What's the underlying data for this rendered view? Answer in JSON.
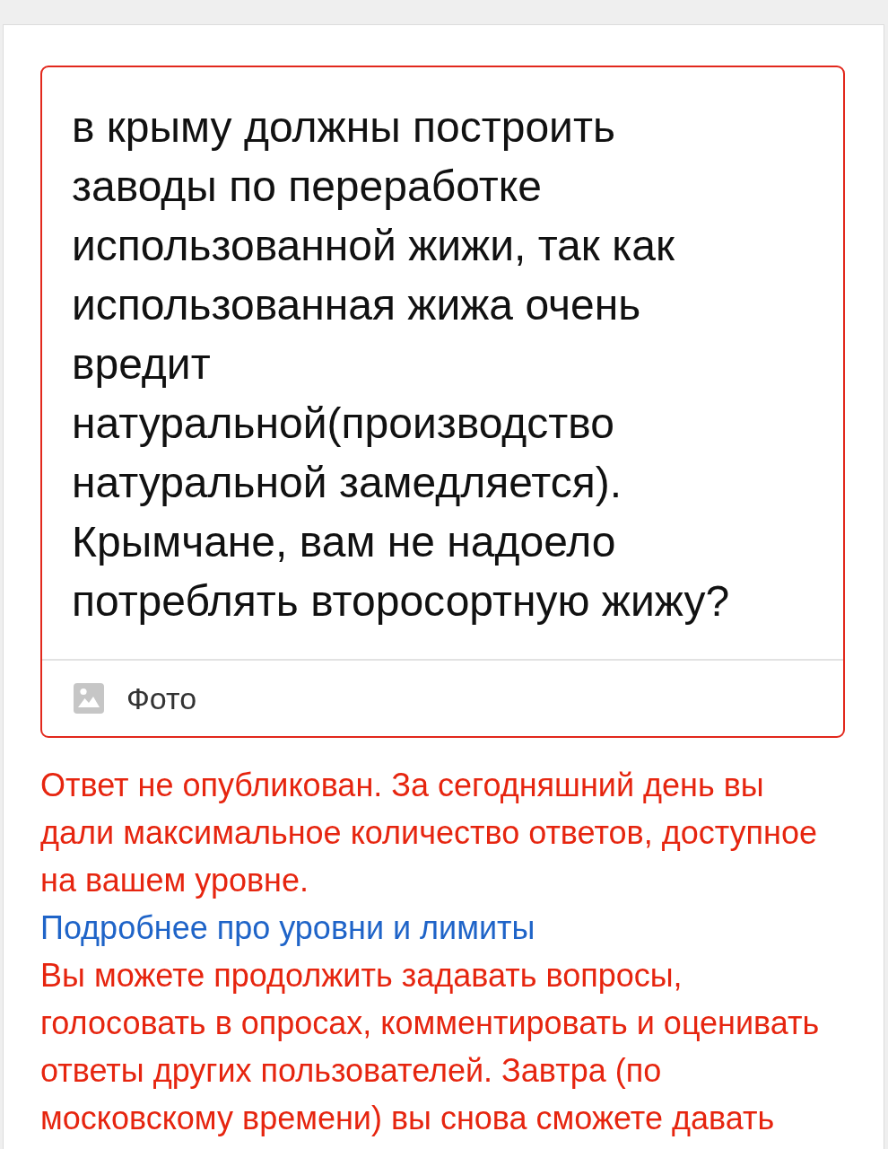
{
  "answer_editor": {
    "value": "в крыму должны построить заводы по переработке использованной жижи, так как использованная жижа очень вредит натуральной(производство натуральной замедляется). Крымчане, вам не надоело потреблять второсортную жижу?",
    "error": true,
    "photo_button": {
      "label": "Фото"
    }
  },
  "notice": {
    "error_message": "Ответ не опубликован. За сегодняшний день вы дали максимальное количество ответов, доступное на вашем уровне.",
    "link": "Подробнее про уровни и лимиты",
    "info_message": "Вы можете продолжить задавать вопросы, голосовать в опросах, комментировать и оценивать ответы других пользователей. Завтра (по московскому времени) вы снова сможете давать"
  }
}
